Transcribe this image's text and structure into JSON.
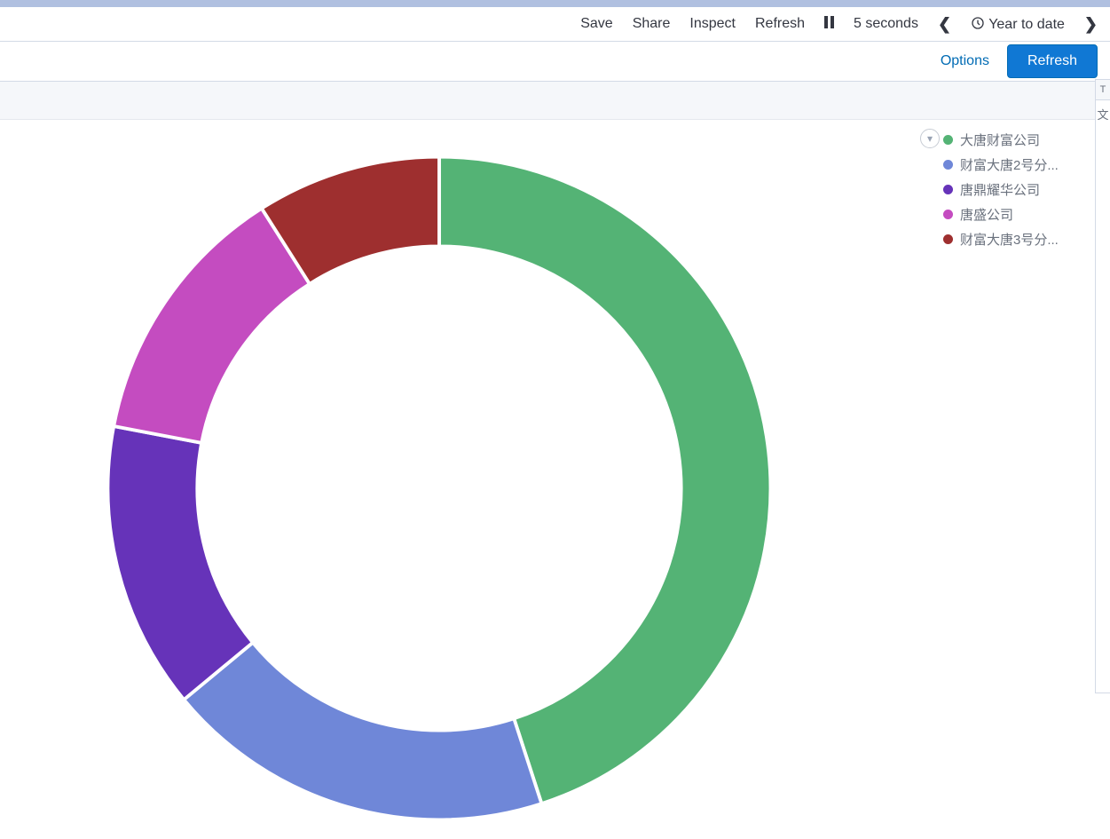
{
  "toolbar": {
    "save": "Save",
    "share": "Share",
    "inspect": "Inspect",
    "refresh": "Refresh",
    "interval": "5 seconds",
    "range": "Year to date"
  },
  "subbar": {
    "options": "Options",
    "refresh": "Refresh"
  },
  "side_sliver": {
    "tab": "T",
    "char": "文"
  },
  "legend": [
    {
      "label": "大唐财富公司",
      "color": "#54b375"
    },
    {
      "label": "财富大唐2号分...",
      "color": "#6f87d8"
    },
    {
      "label": "唐鼎耀华公司",
      "color": "#6633b9"
    },
    {
      "label": "唐盛公司",
      "color": "#c44cc0"
    },
    {
      "label": "财富大唐3号分...",
      "color": "#9e2f2f"
    }
  ],
  "chart_data": {
    "type": "pie",
    "donut": true,
    "title": "",
    "series": [
      {
        "name": "大唐财富公司",
        "value": 45,
        "color": "#54b375"
      },
      {
        "name": "财富大唐2号分...",
        "value": 19,
        "color": "#6f87d8"
      },
      {
        "name": "唐鼎耀华公司",
        "value": 14,
        "color": "#6633b9"
      },
      {
        "name": "唐盛公司",
        "value": 13,
        "color": "#c44cc0"
      },
      {
        "name": "财富大唐3号分...",
        "value": 9,
        "color": "#9e2f2f"
      }
    ],
    "inner_radius_pct": 73,
    "start_angle_deg": 0,
    "direction": "clockwise"
  }
}
